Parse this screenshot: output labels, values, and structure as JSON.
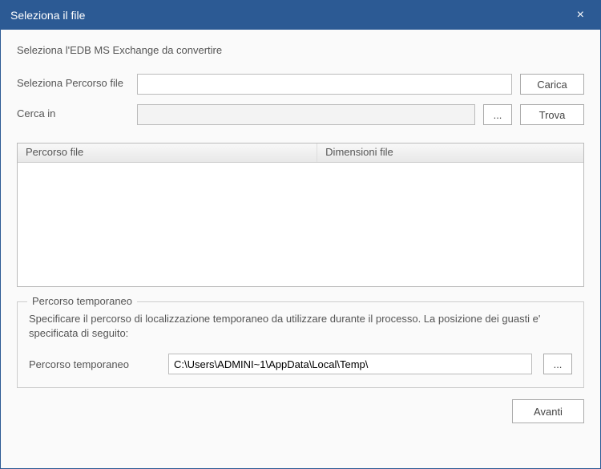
{
  "titlebar": {
    "title": "Seleziona il file",
    "close": "×"
  },
  "subtitle": "Seleziona l'EDB MS Exchange da convertire",
  "form": {
    "select_path_label": "Seleziona Percorso file",
    "select_path_value": "",
    "load_button": "Carica",
    "search_in_label": "Cerca in",
    "search_in_value": "",
    "browse_button": "...",
    "find_button": "Trova"
  },
  "table": {
    "columns": [
      "Percorso file",
      "Dimensioni file"
    ],
    "rows": []
  },
  "temp_path": {
    "legend": "Percorso temporaneo",
    "description": "Specificare il percorso di localizzazione temporaneo da utilizzare durante il processo. La posizione dei guasti e' specificata di seguito:",
    "label": "Percorso temporaneo",
    "value": "C:\\Users\\ADMINI~1\\AppData\\Local\\Temp\\",
    "browse_button": "..."
  },
  "footer": {
    "next_button": "Avanti"
  }
}
